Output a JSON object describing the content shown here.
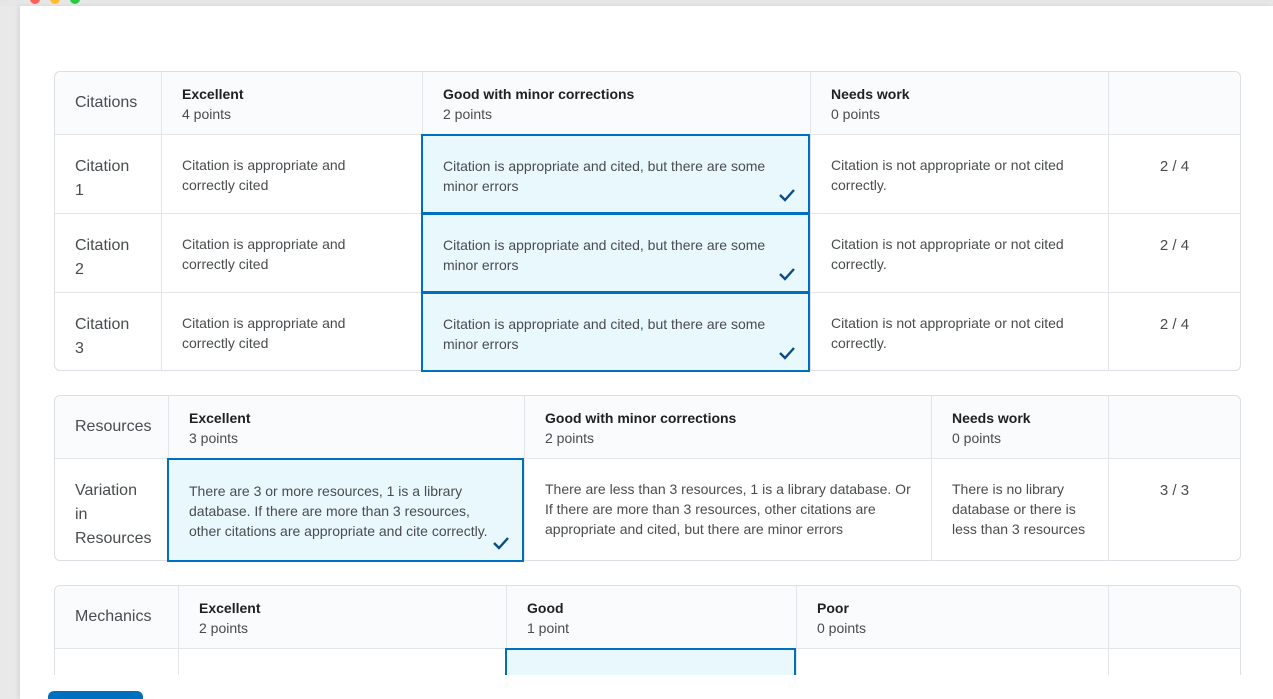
{
  "colors": {
    "accent": "#006fbf",
    "selected_bg": "#e8f8fd",
    "border": "#dcdfe3"
  },
  "rubrics": [
    {
      "criterion_group": "Citations",
      "levels": [
        {
          "name": "Excellent",
          "points": "4 points"
        },
        {
          "name": "Good with minor corrections",
          "points": "2 points"
        },
        {
          "name": "Needs work",
          "points": "0 points"
        }
      ],
      "criteria": [
        {
          "name": "Citation 1",
          "descriptions": [
            "Citation is appropriate and correctly cited",
            "Citation is appropriate and cited, but there are some minor errors",
            "Citation is not appropriate or not cited correctly."
          ],
          "selected_level": 1,
          "score": "2 / 4"
        },
        {
          "name": "Citation 2",
          "descriptions": [
            "Citation is appropriate and correctly cited",
            "Citation is appropriate and cited, but there are some minor errors",
            "Citation is not appropriate or not cited correctly."
          ],
          "selected_level": 1,
          "score": "2 / 4"
        },
        {
          "name": "Citation 3",
          "descriptions": [
            "Citation is appropriate and correctly cited",
            "Citation is appropriate and cited, but there are some minor errors",
            "Citation is not appropriate or not cited correctly."
          ],
          "selected_level": 1,
          "score": "2 / 4"
        }
      ]
    },
    {
      "criterion_group": "Resources",
      "levels": [
        {
          "name": "Excellent",
          "points": "3 points"
        },
        {
          "name": "Good with minor corrections",
          "points": "2 points"
        },
        {
          "name": "Needs work",
          "points": "0 points"
        }
      ],
      "criteria": [
        {
          "name": "Variation in Resources",
          "descriptions": [
            "There are 3 or more resources, 1 is a library database. If there are more than 3 resources, other citations are appropriate and cite correctly.",
            "There are less than 3 resources, 1 is a library database. Or If there are more than 3 resources, other citations are appropriate and cited, but there are minor errors",
            "There is no library database or there is less than 3 resources"
          ],
          "selected_level": 0,
          "score": "3 / 3"
        }
      ]
    },
    {
      "criterion_group": "Mechanics",
      "levels": [
        {
          "name": "Excellent",
          "points": "2 points"
        },
        {
          "name": "Good",
          "points": "1 point"
        },
        {
          "name": "Poor",
          "points": "0 points"
        }
      ],
      "criteria": []
    }
  ]
}
